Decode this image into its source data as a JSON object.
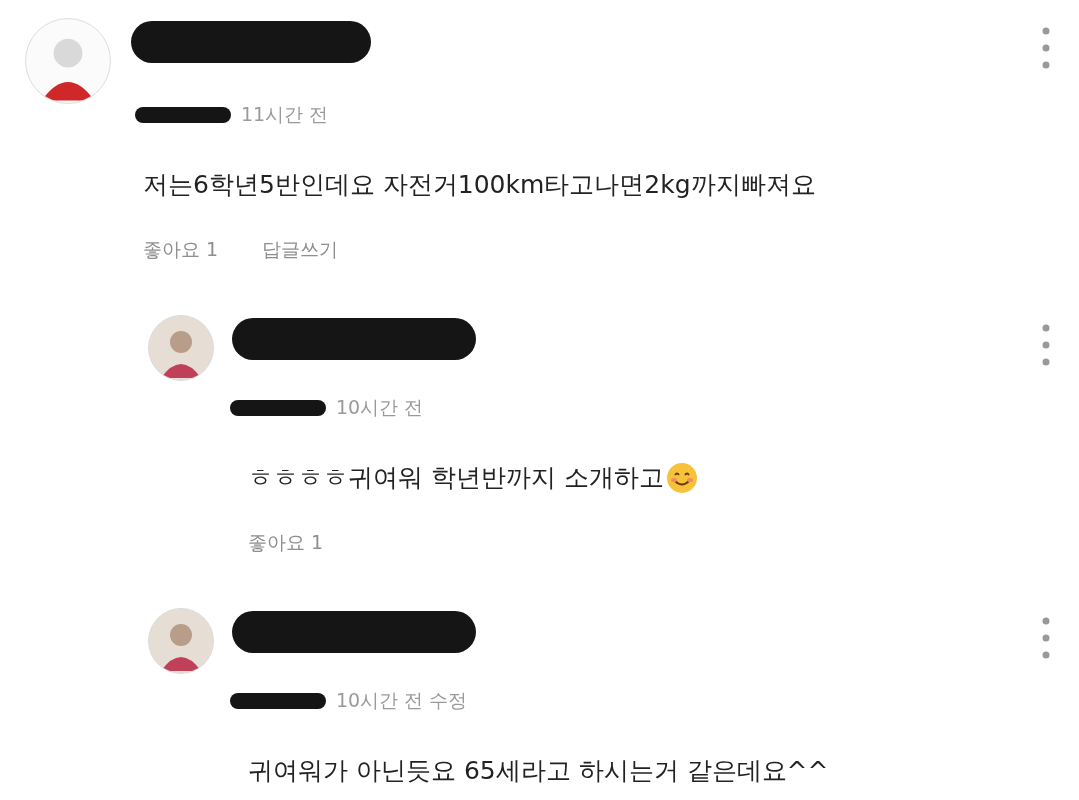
{
  "comments": [
    {
      "name_redacted": true,
      "time": "11시간 전",
      "body": "저는6학년5반인데요 자전거100km타고나면2kg까지빠져요",
      "likes": "좋아요 1",
      "reply_action": "답글쓰기",
      "children": [
        {
          "name_redacted": true,
          "time": "10시간 전",
          "body": "ㅎㅎㅎㅎ귀여워 학년반까지 소개하고",
          "emoji": true,
          "likes": "좋아요 1"
        },
        {
          "name_redacted": true,
          "time": "10시간 전 수정",
          "body": "귀여워가 아닌듯요 65세라고 하시는거 같은데요^^",
          "emoji": false
        }
      ]
    }
  ]
}
